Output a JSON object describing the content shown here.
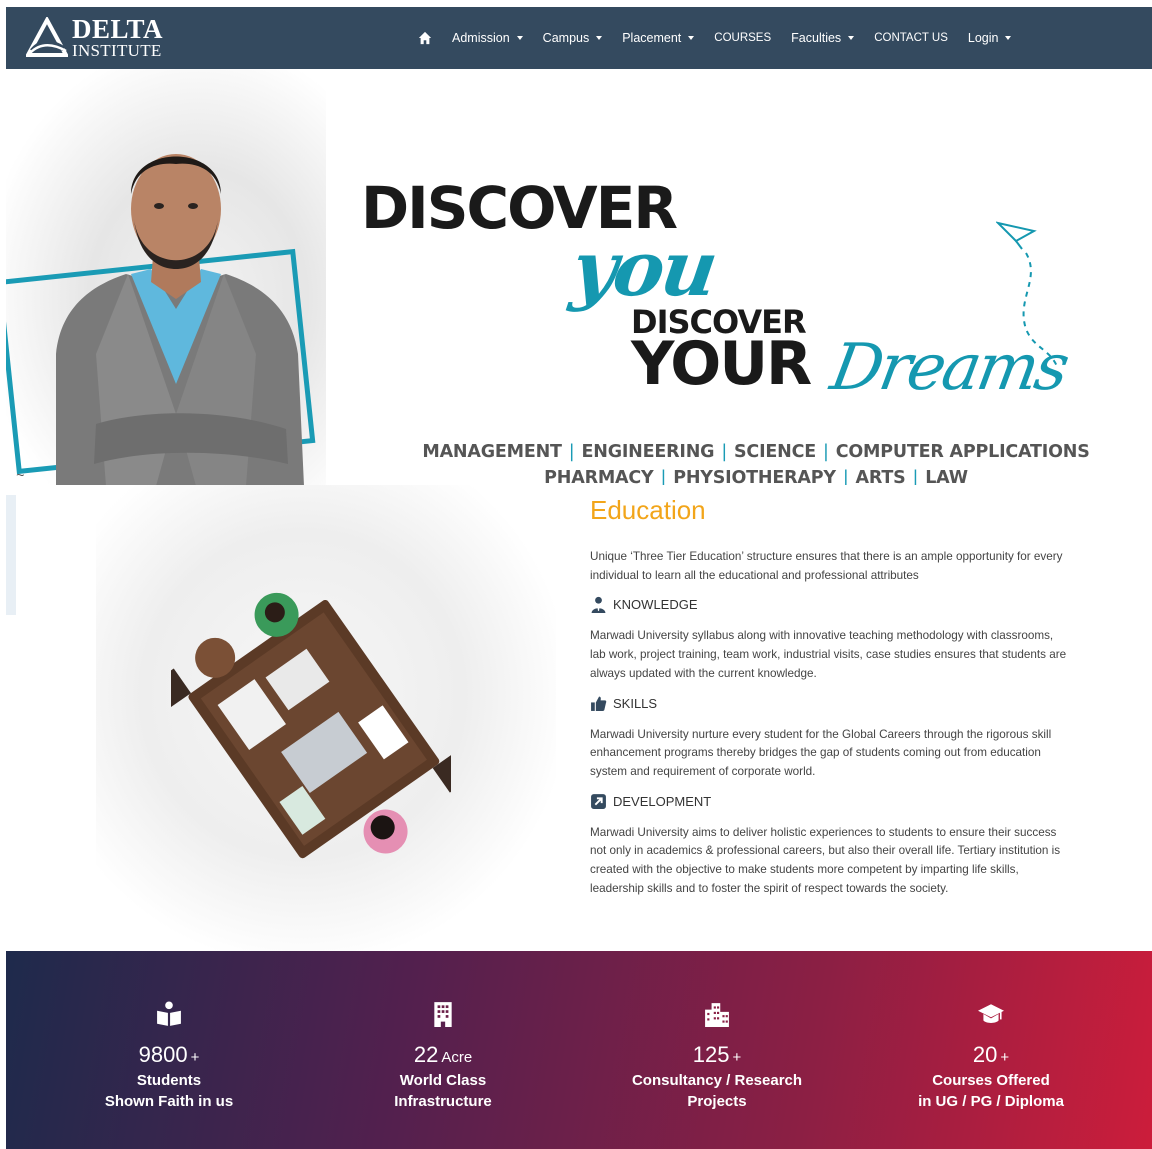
{
  "navbar": {
    "brand_line1": "DELTA",
    "brand_line2": "INSTITUTE",
    "items": [
      {
        "label": "Admission",
        "dropdown": true
      },
      {
        "label": "Campus",
        "dropdown": true
      },
      {
        "label": "Placement",
        "dropdown": true
      },
      {
        "label": "COURSES",
        "dropdown": false
      },
      {
        "label": "Faculties",
        "dropdown": true
      },
      {
        "label": "CONTACT US",
        "dropdown": false
      },
      {
        "label": "Login",
        "dropdown": true
      }
    ],
    "bg_color": "#344a5f"
  },
  "hero": {
    "headline_1": "DISCOVER",
    "headline_2": "you",
    "headline_3": "DISCOVER",
    "headline_4": "YOUR",
    "headline_5": "Dreams",
    "accent_color": "#1598b0",
    "courses_line1": [
      "MANAGEMENT",
      "ENGINEERING",
      "SCIENCE",
      "COMPUTER APPLICATIONS"
    ],
    "courses_line2": [
      "PHARMACY",
      "PHYSIOTHERAPY",
      "ARTS",
      "LAW"
    ],
    "separator": "|"
  },
  "education": {
    "title": "Education",
    "title_color": "#f2a51a",
    "intro": "Unique ‘Three Tier Education’ structure ensures that there is an ample opportunity for every individual to learn all the educational and professional attributes",
    "features": [
      {
        "icon": "person-icon",
        "label": "KNOWLEDGE",
        "text": "Marwadi University syllabus along with innovative teaching methodology with classrooms, lab work, project training, team work, industrial visits, case studies ensures that students are always updated with the current knowledge."
      },
      {
        "icon": "thumbs-up-icon",
        "label": "SKILLS",
        "text": "Marwadi University nurture every student for the Global Careers through the rigorous skill enhancement programs thereby bridges the gap of students coming out from education system and requirement of corporate world."
      },
      {
        "icon": "external-link-icon",
        "label": "DEVELOPMENT",
        "text": "Marwadi University aims to deliver holistic experiences to students to ensure their success not only in academics & professional careers, but also their overall life. Tertiary institution is created with the objective to make students more competent by imparting life skills, leadership skills and to foster the spirit of respect towards the society."
      }
    ]
  },
  "stats": [
    {
      "icon": "book-reader-icon",
      "number": "9800",
      "unit": "+",
      "label1": "Students",
      "label2": "Shown Faith in us"
    },
    {
      "icon": "building-icon",
      "number": "22",
      "unit": "Acre",
      "label1": "World Class",
      "label2": "Infrastructure"
    },
    {
      "icon": "city-icon",
      "number": "125",
      "unit": "+",
      "label1": "Consultancy / Research",
      "label2": "Projects"
    },
    {
      "icon": "graduation-cap-icon",
      "number": "20",
      "unit": "+",
      "label1": "Courses Offered",
      "label2": "in UG / PG / Diploma"
    }
  ]
}
